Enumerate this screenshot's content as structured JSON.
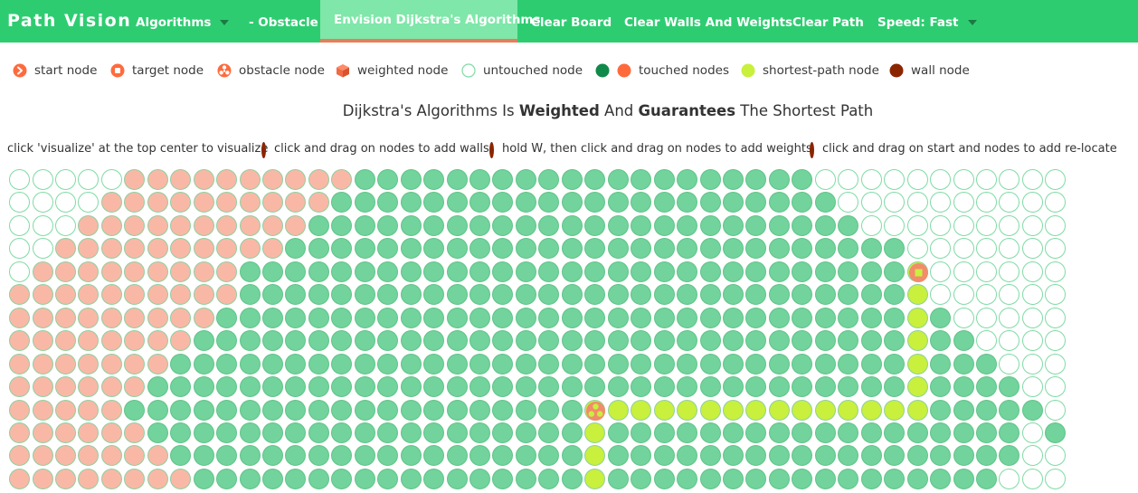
{
  "navbar": {
    "brand": "Path Vision",
    "algorithms_label": "Algorithms",
    "obstacle_label": "- Obstacle",
    "visualize_label": "Envision Dijkstra's Algorithms",
    "clear_board_label": "Clear Board",
    "clear_walls_label": "Clear Walls And Weights",
    "clear_path_label": "Clear Path",
    "speed_label": "Speed: Fast"
  },
  "legend": {
    "start": "start node",
    "target": "target node",
    "obstacle": "obstacle node",
    "weighted": "weighted node",
    "untouched": "untouched node",
    "touched": "touched nodes",
    "shortest": "shortest-path node",
    "wall": "wall node"
  },
  "headline": {
    "p1": "Dijkstra's Algorithms Is ",
    "b1": "Weighted",
    "p2": " And ",
    "b2": "Guarantees",
    "p3": " The Shortest Path"
  },
  "hints": [
    "click 'visualize' at the top center to visualize",
    "click and drag on nodes to add walls",
    "hold W, then click and drag on nodes to add weights",
    "click and drag on start and nodes to add re-locate"
  ],
  "colors": {
    "navbar": "#2ecc71",
    "nav_active": "#7fe7a9",
    "nav_active_border": "#e67e5a",
    "untouched_fill": "#ffffff",
    "untouched_border": "#7fdba5",
    "visited_early": "#f9b8a6",
    "visited_late": "#72d39c",
    "shortest_path": "#c8f03c",
    "touched_legend_green": "#0f8a4a",
    "touched_legend_orange": "#ff6a3d",
    "wall": "#8b2500"
  },
  "board": {
    "state_codes": "u=untouched, t=visited (early, salmon), g=visited (late, green), s=shortest-path, S=start, T=target",
    "rows": [
      "uuuuuttttttttttgggggggggggggggggggguuuuuuuuuuu",
      "uuuuttttttttttgggggggggggggggggggggguuuuuuuuuu",
      "uuuttttttttttgggggggggggggggggggggggguuuuuuuuu",
      "uuttttttttttggggggggggggggggggggggggggguuuuuuu",
      "utttttttttgggggggggggggggggggggggggggggTuuuuuu",
      "ttttttttttgggggggggggggggggggggggggggggsuuuuuu",
      "tttttttttggggggggggggggggggggggggggggggsguuuuu",
      "ttttttttgggggggggggggggggggggggggggggggsgguuuu",
      "tttttttggggggggggggggggggggggggggggggggsggguuu",
      "ttttttgggggggggggggggggggggggggggggggggsgggguu",
      "tttttggggggggggggggggggggSssssssssssssssgggggu",
      "ttttttgggggggggggggggggggsggggggggggggggggggug",
      "tttttttggggggggggggggggggsgggggggggggggggggguu",
      "ttttttttgggggggggggggggggsggggggggggggggggguuu"
    ]
  }
}
